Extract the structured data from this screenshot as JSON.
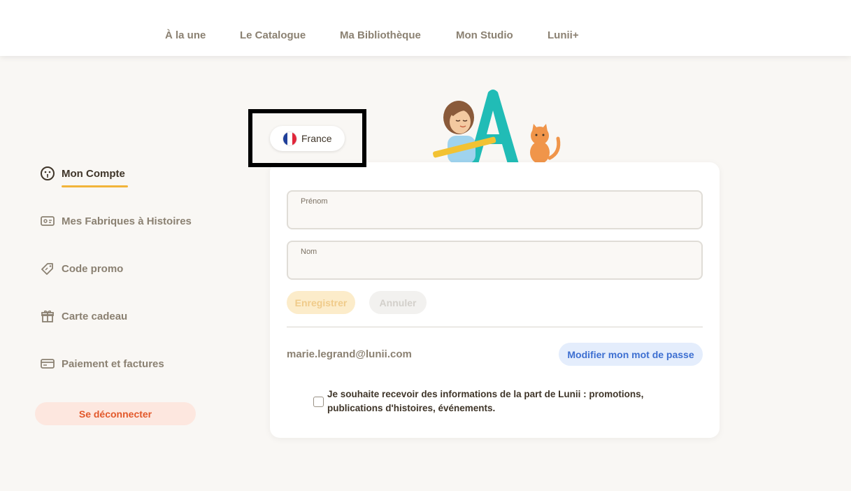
{
  "nav": {
    "items": [
      "À la une",
      "Le Catalogue",
      "Ma Bibliothèque",
      "Mon Studio",
      "Lunii+"
    ]
  },
  "sidebar": {
    "items": [
      {
        "label": "Mon Compte",
        "icon": "face-icon",
        "active": true
      },
      {
        "label": "Mes Fabriques à Histoires",
        "icon": "device-icon",
        "active": false
      },
      {
        "label": "Code promo",
        "icon": "tag-icon",
        "active": false
      },
      {
        "label": "Carte cadeau",
        "icon": "gift-icon",
        "active": false
      },
      {
        "label": "Paiement et factures",
        "icon": "card-icon",
        "active": false
      }
    ],
    "logout_label": "Se déconnecter"
  },
  "country": {
    "label": "France",
    "flag": "france-flag-icon"
  },
  "form": {
    "first_name": {
      "label": "Prénom",
      "value": ""
    },
    "last_name": {
      "label": "Nom",
      "value": ""
    },
    "save_label": "Enregistrer",
    "cancel_label": "Annuler",
    "email": "marie.legrand@lunii.com",
    "change_password_label": "Modifier mon mot de passe",
    "consent_text": "Je souhaite recevoir des informations de la part de Lunii : promotions, publications d'histoires, événements.",
    "consent_checked": false
  },
  "colors": {
    "accent": "#f2b43a",
    "logout": "#e2582a",
    "link_blue": "#3d6fd1",
    "background": "#f9f7f4"
  }
}
